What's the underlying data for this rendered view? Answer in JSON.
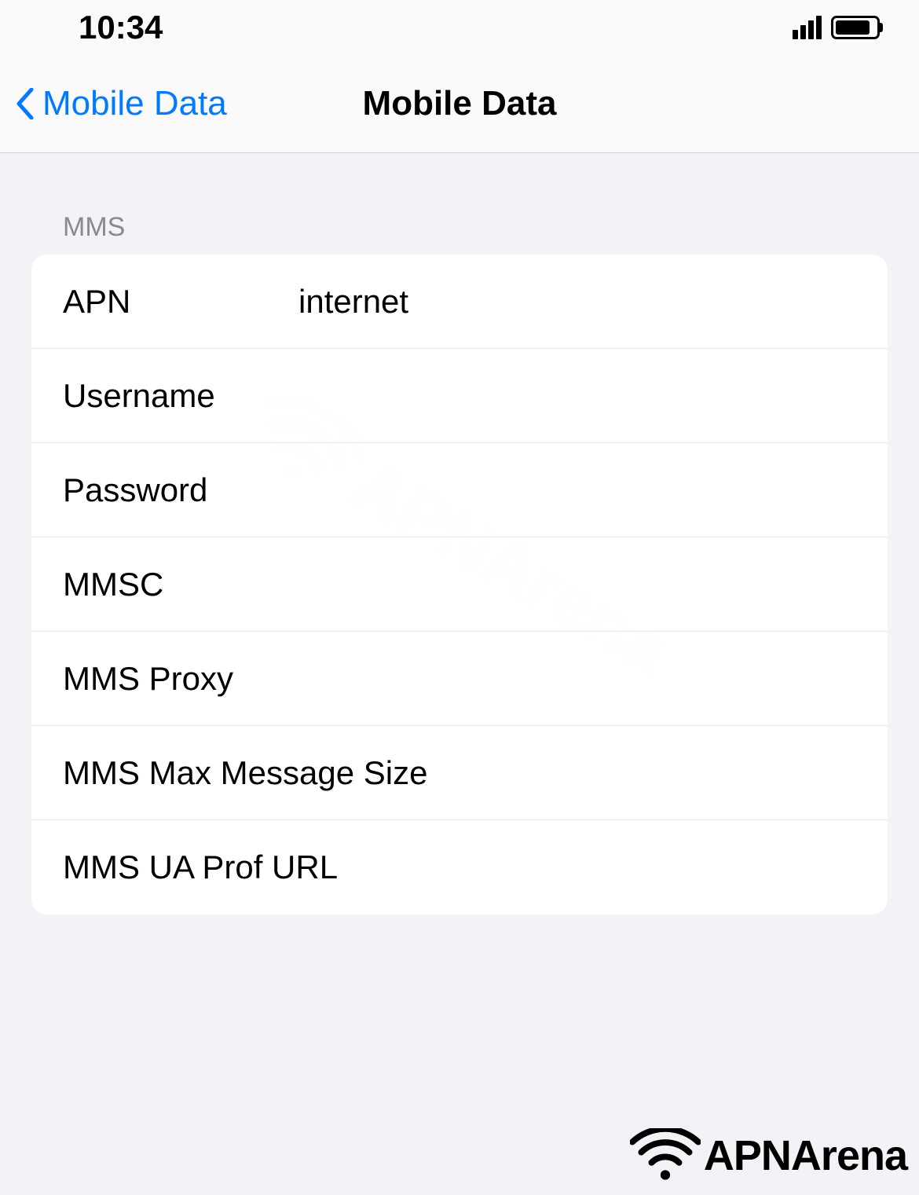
{
  "status": {
    "time": "10:34"
  },
  "nav": {
    "back_label": "Mobile Data",
    "title": "Mobile Data"
  },
  "section": {
    "header": "MMS"
  },
  "fields": {
    "apn": {
      "label": "APN",
      "value": "internet"
    },
    "username": {
      "label": "Username",
      "value": ""
    },
    "password": {
      "label": "Password",
      "value": ""
    },
    "mmsc": {
      "label": "MMSC",
      "value": ""
    },
    "mms_proxy": {
      "label": "MMS Proxy",
      "value": ""
    },
    "mms_max_size": {
      "label": "MMS Max Message Size",
      "value": ""
    },
    "mms_ua_prof": {
      "label": "MMS UA Prof URL",
      "value": ""
    }
  },
  "watermark": {
    "text": "APNArena"
  }
}
